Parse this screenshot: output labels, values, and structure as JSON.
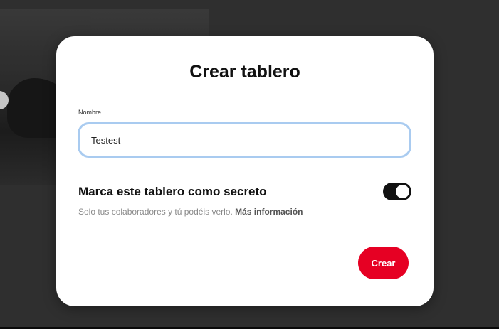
{
  "modal": {
    "title": "Crear tablero",
    "name_label": "Nombre",
    "name_value": "Testest",
    "secret_title": "Marca este tablero como secreto",
    "secret_desc": "Solo tus colaboradores y tú podéis verlo. ",
    "more_info": "Más información",
    "secret_toggle_on": true,
    "create_label": "Crear"
  },
  "colors": {
    "accent": "#e60023",
    "toggle_on": "#111111",
    "input_focus_border": "#a9cbf0",
    "backdrop": "#2f2f2f"
  }
}
